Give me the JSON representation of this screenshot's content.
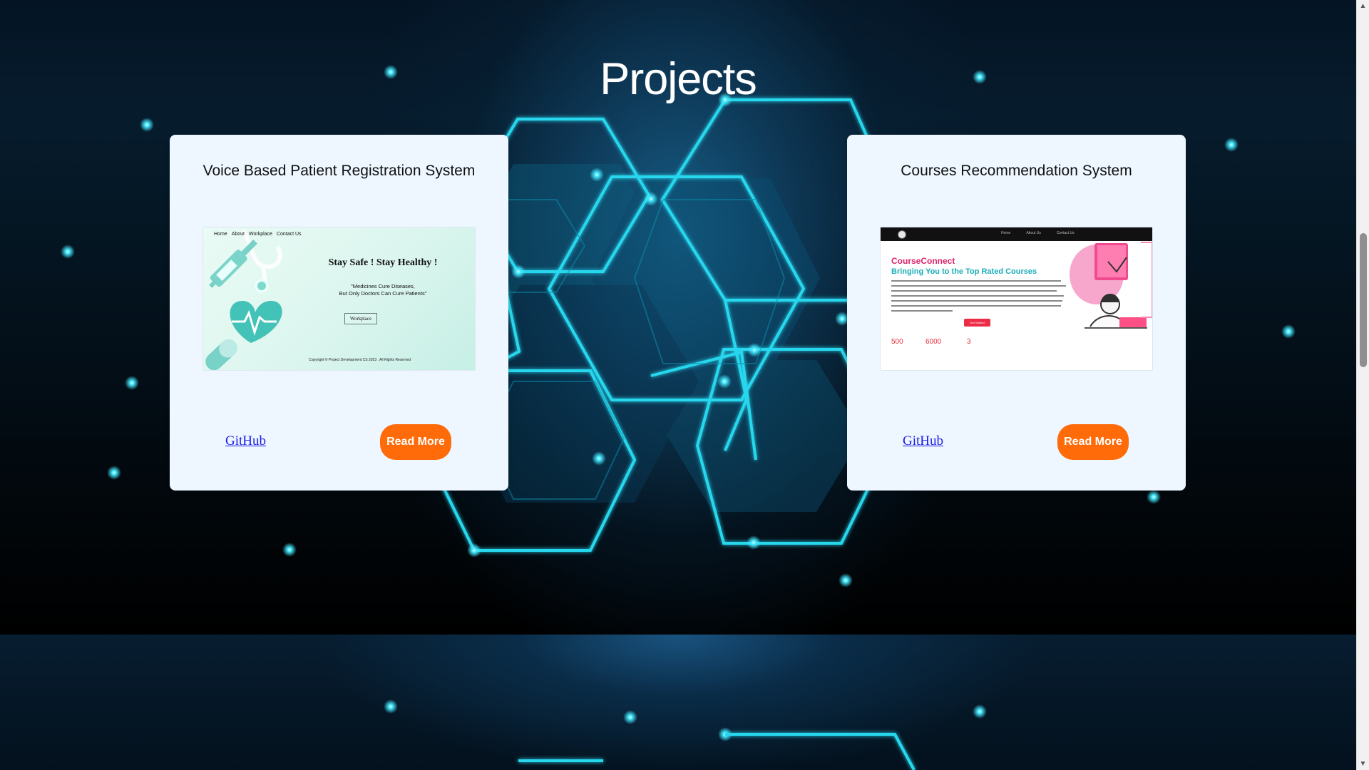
{
  "page": {
    "title": "Projects",
    "colors": {
      "background": "#000000",
      "glow": "#28d7ee",
      "card": "#eef7ff",
      "button": "#ff6b08",
      "link": "#1b1be8"
    }
  },
  "projects": [
    {
      "title": "Voice Based Patient Registration System",
      "github_label": "GitHub",
      "read_more_label": "Read More",
      "preview": {
        "nav": [
          "Home",
          "About",
          "Workplace",
          "Contact Us"
        ],
        "headline": "Stay Safe ! Stay Healthy !",
        "quote": "\"Medicines Cure Diseases,\nBut Only Doctors Can Cure Patients\"",
        "workplace_label": "Workplace",
        "copyright": "Copyright © Project Development CS 2023 . All Rights Reserved"
      }
    },
    {
      "title": "Courses Recommendation System",
      "github_label": "GitHub",
      "read_more_label": "Read More",
      "preview": {
        "nav": [
          "Home",
          "About Us",
          "Contact Us"
        ],
        "brand": "CourseConnect",
        "tagline": "Bringing You to the Top Rated Courses",
        "cta_label": "Get Started",
        "stats": [
          "500",
          "6000",
          "3"
        ]
      }
    }
  ],
  "icons": {
    "scroll_up": "scroll-up-icon",
    "scroll_down": "scroll-down-icon",
    "heart": "heart-icon",
    "syringe": "syringe-icon",
    "stethoscope": "stethoscope-icon",
    "student": "student-illustration-icon"
  }
}
